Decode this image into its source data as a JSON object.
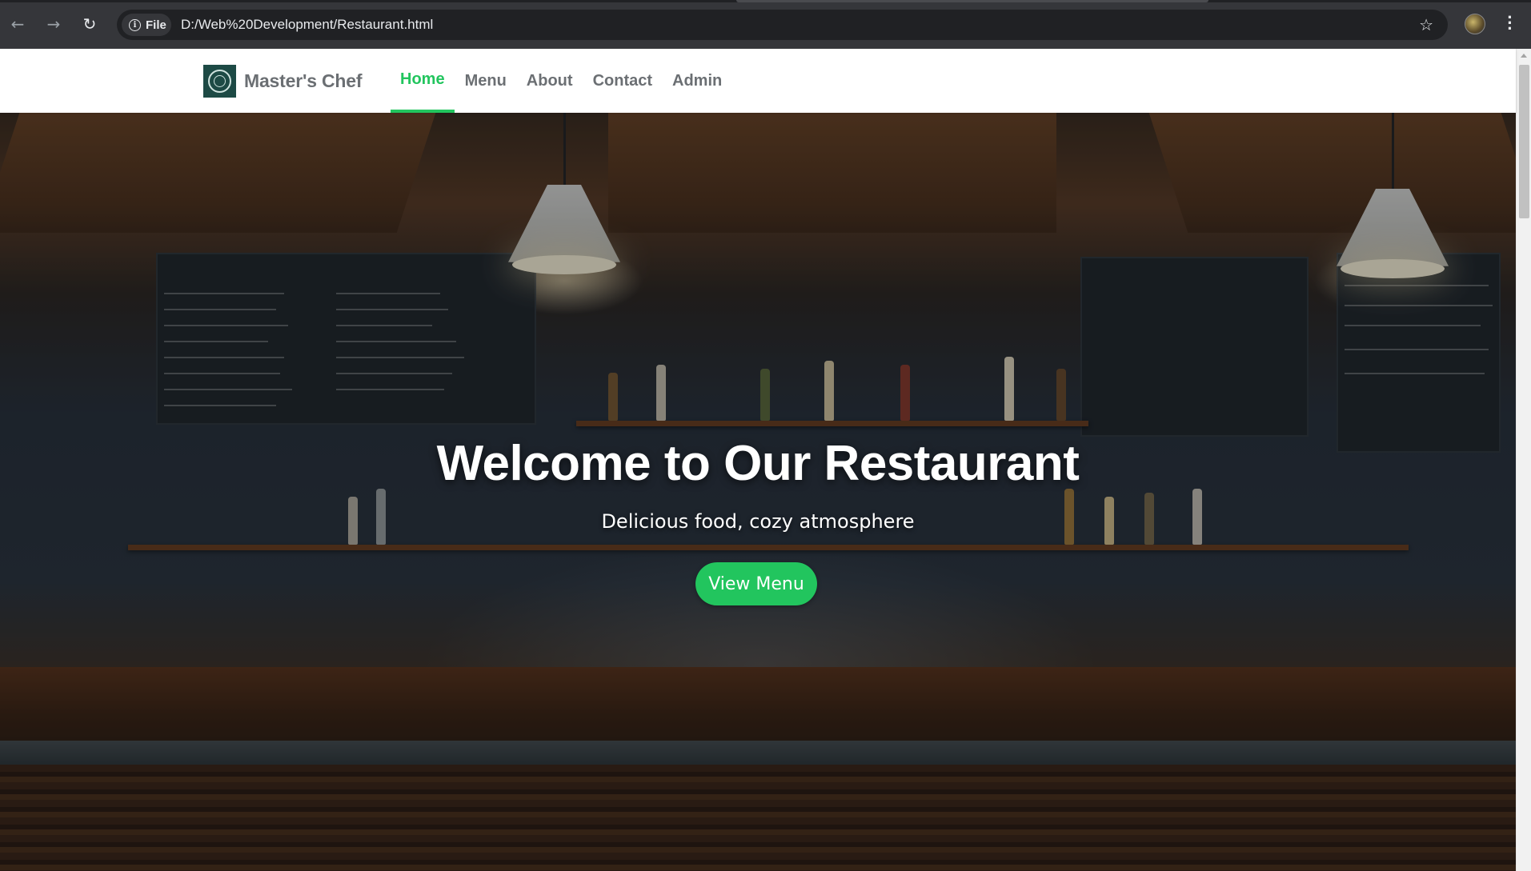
{
  "browser": {
    "back_icon": "arrow-left-icon",
    "forward_icon": "arrow-right-icon",
    "reload_icon": "reload-icon",
    "site_chip_label": "File",
    "url": "D:/Web%20Development/Restaurant.html",
    "bookmark_icon": "star-icon",
    "menu_icon": "kebab-menu-icon"
  },
  "navbar": {
    "brand_name": "Master's Chef",
    "links": [
      {
        "label": "Home",
        "active": true
      },
      {
        "label": "Menu",
        "active": false
      },
      {
        "label": "About",
        "active": false
      },
      {
        "label": "Contact",
        "active": false
      },
      {
        "label": "Admin",
        "active": false
      }
    ]
  },
  "hero": {
    "title": "Welcome to Our Restaurant",
    "subtitle": "Delicious food, cozy atmosphere",
    "button_label": "View Menu"
  },
  "colors": {
    "accent": "#22c55e",
    "nav_text": "#6b6f73",
    "browser_bar": "#35363a"
  }
}
